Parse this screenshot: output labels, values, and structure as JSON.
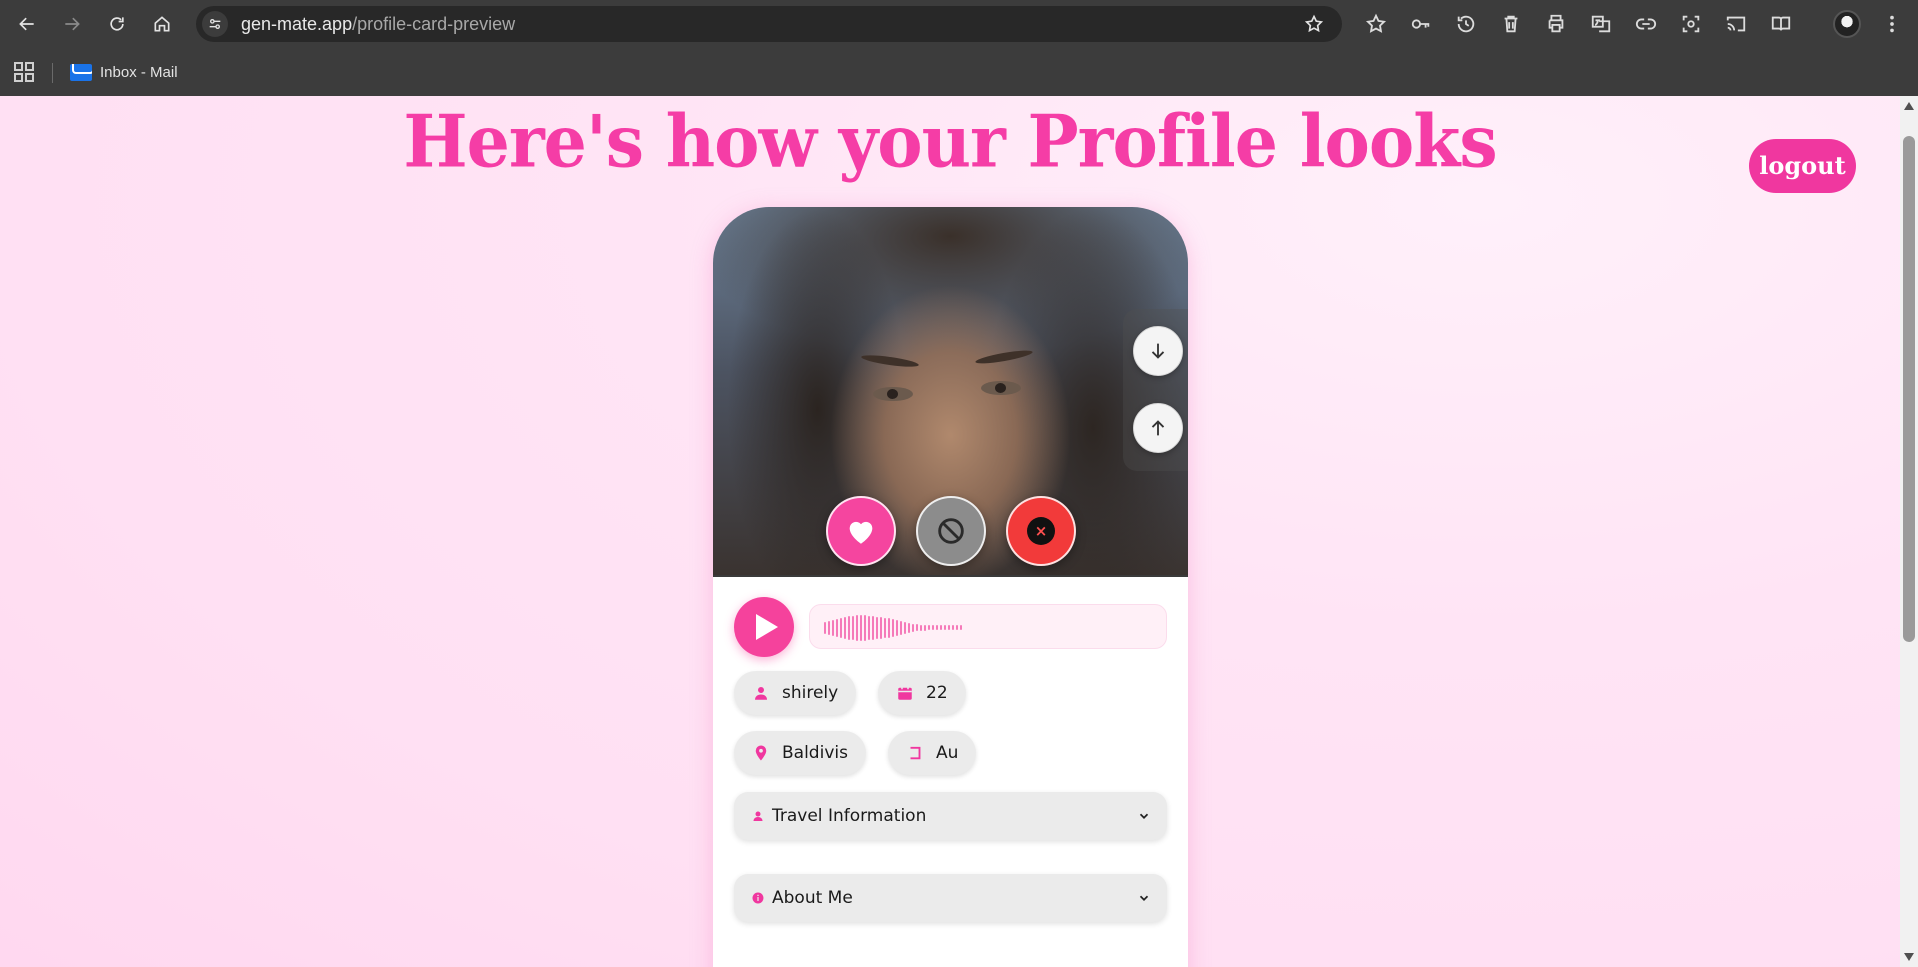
{
  "browser": {
    "url_domain": "gen-mate.app",
    "url_path": "/profile-card-preview",
    "bookmarks": [
      {
        "label": "Inbox - Mail",
        "icon": "mail-icon"
      }
    ]
  },
  "page": {
    "title": "Here's how your Profile looks",
    "logout_label": "logout"
  },
  "card": {
    "photo_alt": "profile-photo",
    "controls": {
      "scroll_down_icon": "arrow-down-icon",
      "scroll_up_icon": "arrow-up-icon"
    },
    "actions": [
      {
        "name": "like",
        "icon": "heart-icon",
        "color": "#f5459f"
      },
      {
        "name": "block",
        "icon": "block-icon",
        "color": "#8c8c8c"
      },
      {
        "name": "pass",
        "icon": "close-icon",
        "label": "×",
        "color": "#f23a3a"
      }
    ],
    "audio": {
      "play_icon": "play-icon",
      "progress": 0.0
    },
    "chips": {
      "name": "shirely",
      "age": "22",
      "location": "Baldivis",
      "country": "Au"
    },
    "sections": [
      {
        "label": "Travel Information",
        "icon": "person-icon",
        "expanded": false
      },
      {
        "label": "About Me",
        "icon": "info-icon",
        "expanded": false
      }
    ]
  },
  "colors": {
    "accent": "#f0379f",
    "background": "#ffe4f5"
  }
}
